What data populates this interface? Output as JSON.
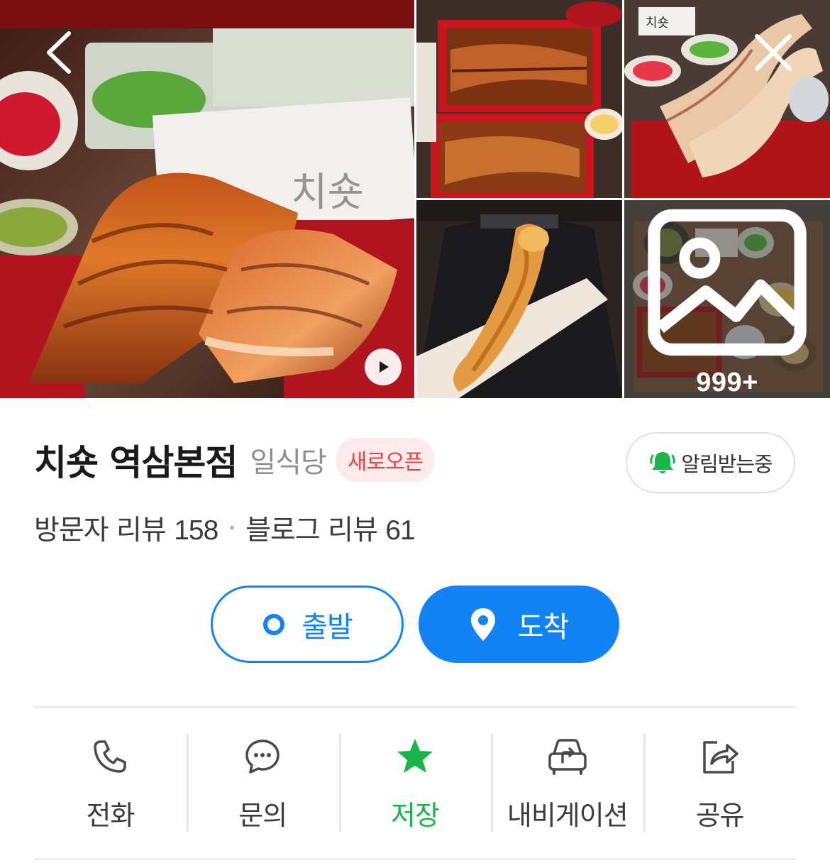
{
  "place": {
    "name": "치숏 역삼본점",
    "category": "일식당",
    "badge": "새로오픈"
  },
  "notify_button": {
    "label": "알림받는중"
  },
  "reviews": {
    "visitor_label": "방문자 리뷰",
    "visitor_count": "158",
    "separator": "•",
    "blog_label": "블로그 리뷰",
    "blog_count": "61"
  },
  "gallery": {
    "more_count": "999+"
  },
  "route": {
    "start_label": "출발",
    "end_label": "도착"
  },
  "actions": [
    {
      "label": "전화",
      "icon": "phone-icon"
    },
    {
      "label": "문의",
      "icon": "chat-icon"
    },
    {
      "label": "저장",
      "icon": "star-icon",
      "active": true
    },
    {
      "label": "내비게이션",
      "icon": "car-navigation-icon"
    },
    {
      "label": "공유",
      "icon": "share-icon"
    }
  ],
  "colors": {
    "accent_blue": "#1283f4",
    "saved_green": "#19b54a",
    "badge_red": "#e8434a",
    "badge_bg": "#fdeaea"
  }
}
